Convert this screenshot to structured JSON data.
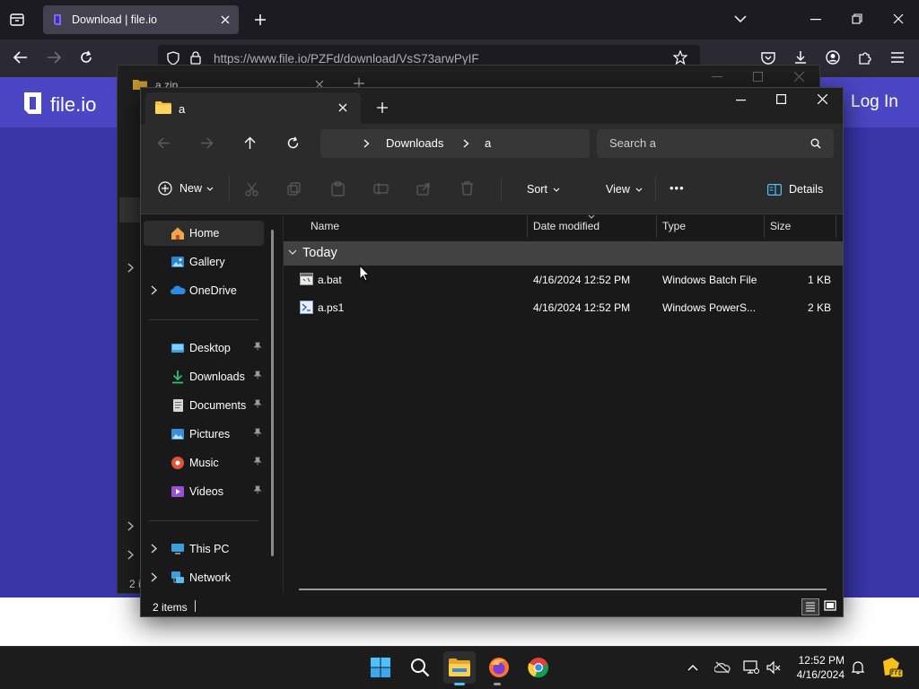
{
  "browser": {
    "tab_title": "Download | file.io",
    "url": "https://www.file.io/PZFd/download/VsS73arwPyIF"
  },
  "website": {
    "logo_text": "file.io",
    "login_label": "Log In"
  },
  "background_window": {
    "tab_title": "a.zip",
    "status_partial": "2 i"
  },
  "explorer": {
    "tab_title": "a",
    "new_tab_symbol": "+",
    "breadcrumb": [
      "Downloads",
      "a"
    ],
    "search_placeholder": "Search a",
    "toolbar": {
      "new_label": "New",
      "sort_label": "Sort",
      "view_label": "View",
      "more_label": "•••",
      "details_label": "Details"
    },
    "nav": {
      "home": "Home",
      "gallery": "Gallery",
      "onedrive": "OneDrive",
      "desktop": "Desktop",
      "downloads": "Downloads",
      "documents": "Documents",
      "pictures": "Pictures",
      "music": "Music",
      "videos": "Videos",
      "thispc": "This PC",
      "network": "Network"
    },
    "columns": {
      "name": "Name",
      "date": "Date modified",
      "type": "Type",
      "size": "Size"
    },
    "group_label": "Today",
    "files": [
      {
        "name": "a.bat",
        "date": "4/16/2024 12:52 PM",
        "type": "Windows Batch File",
        "size": "1 KB"
      },
      {
        "name": "a.ps1",
        "date": "4/16/2024 12:52 PM",
        "type": "Windows PowerS...",
        "size": "2 KB"
      }
    ],
    "status": "2 items"
  },
  "taskbar": {
    "time": "12:52 PM",
    "date": "4/16/2024",
    "apps": [
      "windows-start",
      "search",
      "file-explorer",
      "firefox",
      "chrome"
    ]
  },
  "colors": {
    "site_header": "#4b47c4",
    "site_body": "#3936a8",
    "folder_yellow": "#f5c342",
    "explorer_bg": "#191919"
  }
}
